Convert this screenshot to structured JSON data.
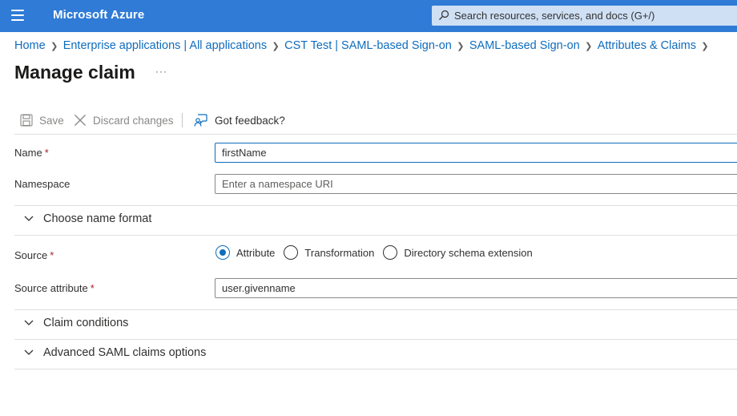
{
  "topbar": {
    "brand": "Microsoft Azure",
    "search_placeholder": "Search resources, services, and docs (G+/)",
    "color": "#2f7bd6"
  },
  "breadcrumb": [
    "Home",
    "Enterprise applications | All applications",
    "CST Test | SAML-based Sign-on",
    "SAML-based Sign-on",
    "Attributes & Claims"
  ],
  "page": {
    "title": "Manage claim",
    "more": "···"
  },
  "toolbar": {
    "save_label": "Save",
    "discard_label": "Discard changes",
    "feedback_label": "Got feedback?"
  },
  "form": {
    "name_label": "Name",
    "name_value": "firstName",
    "namespace_label": "Namespace",
    "namespace_placeholder": "Enter a namespace URI",
    "name_format_section": "Choose name format",
    "source_label": "Source",
    "source_options": [
      "Attribute",
      "Transformation",
      "Directory schema extension"
    ],
    "source_selected": "Attribute",
    "source_attribute_label": "Source attribute",
    "source_attribute_value": "user.givenname",
    "required_mark": "*",
    "claim_conditions_section": "Claim conditions",
    "advanced_section": "Advanced SAML claims options"
  },
  "colors": {
    "link": "#0f6cbd",
    "required": "#a4262c"
  }
}
